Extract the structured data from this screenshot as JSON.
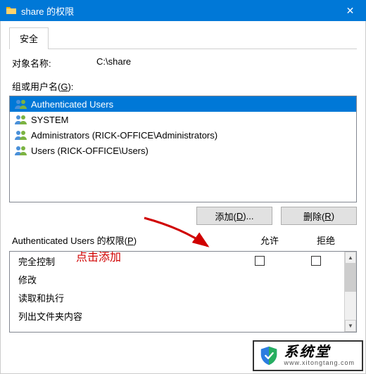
{
  "window": {
    "title": "share 的权限",
    "close_glyph": "✕"
  },
  "tabs": {
    "security": "安全"
  },
  "object": {
    "label": "对象名称:",
    "value": "C:\\share"
  },
  "groups": {
    "label_pre": "组或用户名(",
    "label_key": "G",
    "label_post": "):",
    "items": [
      {
        "name": "Authenticated Users",
        "selected": true
      },
      {
        "name": "SYSTEM",
        "selected": false
      },
      {
        "name": "Administrators (RICK-OFFICE\\Administrators)",
        "selected": false
      },
      {
        "name": "Users (RICK-OFFICE\\Users)",
        "selected": false
      }
    ]
  },
  "hint": "点击添加",
  "buttons": {
    "add_pre": "添加(",
    "add_key": "D",
    "add_post": ")...",
    "remove_pre": "删除(",
    "remove_key": "R",
    "remove_post": ")"
  },
  "perms": {
    "title_pre": "Authenticated Users 的权限(",
    "title_key": "P",
    "title_post": ")",
    "col_allow": "允许",
    "col_deny": "拒绝",
    "rows": [
      {
        "name": "完全控制",
        "allow_visible": true,
        "deny_visible": true
      },
      {
        "name": "修改",
        "allow_visible": false,
        "deny_visible": false
      },
      {
        "name": "读取和执行",
        "allow_visible": false,
        "deny_visible": false
      },
      {
        "name": "列出文件夹内容",
        "allow_visible": false,
        "deny_visible": false
      }
    ]
  },
  "watermark": {
    "main": "系统堂",
    "sub": "www.xitongtang.com"
  },
  "scroll": {
    "up": "▲",
    "down": "▼"
  }
}
